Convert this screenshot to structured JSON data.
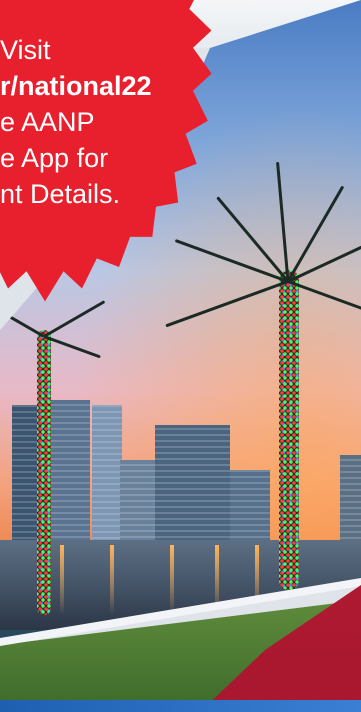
{
  "promo": {
    "lines": [
      "Visit",
      "r/national22",
      "e AANP",
      "e App for",
      "nt Details."
    ]
  },
  "colors": {
    "burst_red": "#e8202e",
    "band_red": "#c81f3a",
    "band_blue": "#1e5fb0"
  },
  "image": {
    "subject": "palm-trees-city-skyline-photo"
  }
}
